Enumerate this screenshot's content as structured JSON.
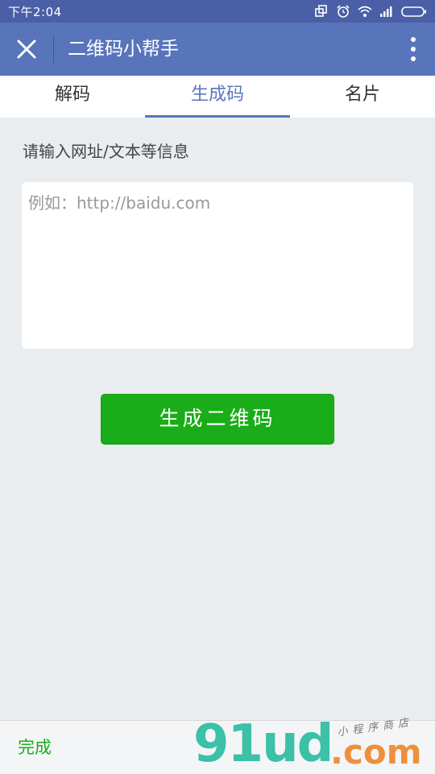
{
  "status_bar": {
    "time": "下午2:04",
    "icons": [
      "copy-icon",
      "alarm-icon",
      "wifi-icon",
      "signal-icon",
      "battery-icon"
    ]
  },
  "navbar": {
    "title": "二维码小帮手",
    "close_icon": "close-icon",
    "more_icon": "more-vertical-icon"
  },
  "tabs": [
    {
      "label": "解码",
      "active": false
    },
    {
      "label": "生成码",
      "active": true
    },
    {
      "label": "名片",
      "active": false
    }
  ],
  "form": {
    "prompt": "请输入网址/文本等信息",
    "input_value": "",
    "input_placeholder": "例如：http://baidu.com",
    "generate_button": "生成二维码"
  },
  "keyboard_bar": {
    "done_label": "完成"
  },
  "watermark": {
    "logo_text": "91ud",
    "domain_text": ".com",
    "tagline": "小程序商店"
  },
  "colors": {
    "status_bar": "#4a5fa6",
    "nav_bar": "#5875bb",
    "accent": "#5a76bd",
    "primary_button": "#1aad19",
    "background": "#e9edf0"
  }
}
